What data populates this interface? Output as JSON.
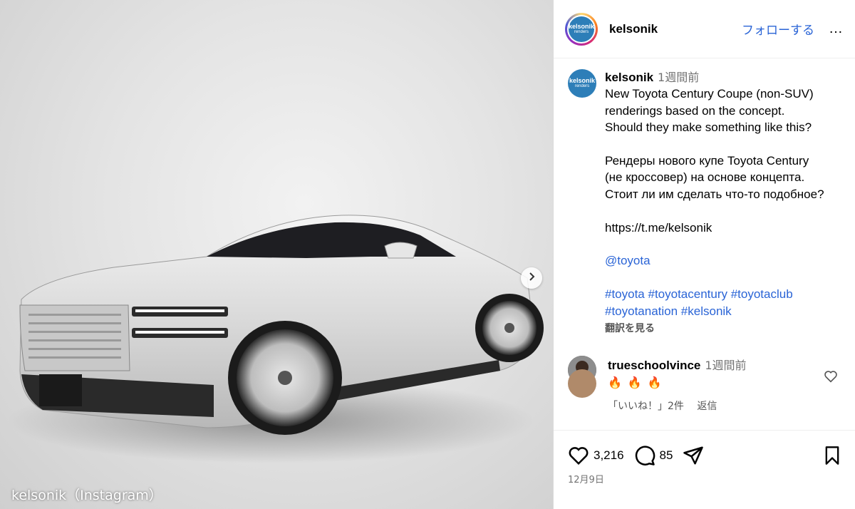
{
  "media": {
    "credit": "kelsonik（Instagram）",
    "next_arrow": "chevron-right-icon"
  },
  "header": {
    "username": "kelsonik",
    "follow_label": "フォローする",
    "more_label": "…",
    "logo_text": "kelsonik",
    "logo_subtext": "renders"
  },
  "caption": {
    "username": "kelsonik",
    "time": "1週間前",
    "lines": [
      "New Toyota Century Coupe (non-SUV)",
      "renderings based on the concept.",
      "Should they make something like this?",
      "Рендеры нового купе Toyota Century",
      "(не кроссовер) на основе концепта.",
      "Стоит ли им сделать что-то подобное?",
      "https://t.me/kelsonik"
    ],
    "mention": "@toyota",
    "hashtags_line1": "#toyota #toyotacentury #toyotaclub",
    "hashtags_line2": "#toyotanation #kelsonik",
    "translate_label": "翻訳を見る"
  },
  "comment": {
    "username": "trueschoolvince",
    "time": "1週間前",
    "text": "🔥🔥🔥",
    "likes_label": "「いいね！」2件",
    "reply_label": "返信"
  },
  "actions": {
    "like_count": "3,216",
    "comment_count": "85",
    "date": "12月9日"
  },
  "colors": {
    "link": "#2a64d6",
    "logo": "#2d7eb8",
    "muted": "#737373"
  }
}
